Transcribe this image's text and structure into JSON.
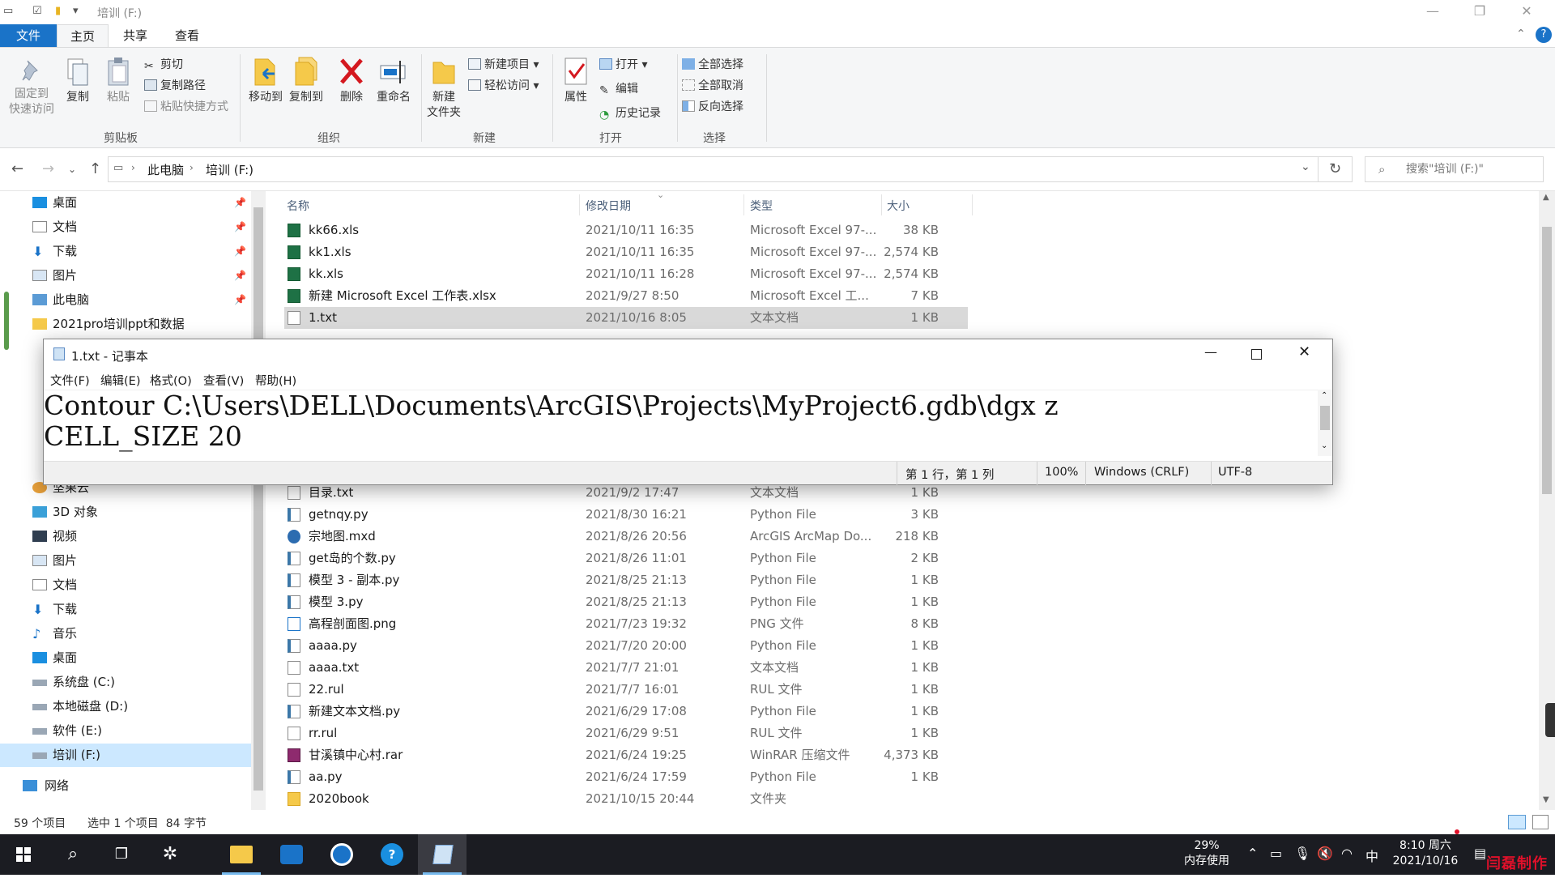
{
  "titlebar": {
    "title": "培训 (F:)",
    "minimize": "—",
    "maximize": "❐",
    "close": "✕"
  },
  "ribbon_tabs": [
    "文件",
    "主页",
    "共享",
    "查看"
  ],
  "ribbon": {
    "clipboard": {
      "pin": "固定到\n快速访问",
      "copy": "复制",
      "paste": "粘贴",
      "cut": "剪切",
      "copy_path": "复制路径",
      "paste_shortcut": "粘贴快捷方式",
      "group": "剪贴板"
    },
    "organize": {
      "move_to": "移动到",
      "copy_to": "复制到",
      "delete": "删除",
      "rename": "重命名",
      "group": "组织"
    },
    "new": {
      "new_folder": "新建\n文件夹",
      "new_item": "新建项目",
      "easy_access": "轻松访问",
      "group": "新建"
    },
    "open": {
      "properties": "属性",
      "open": "打开",
      "edit": "编辑",
      "history": "历史记录",
      "group": "打开"
    },
    "select": {
      "select_all": "全部选择",
      "select_none": "全部取消",
      "invert": "反向选择",
      "group": "选择"
    }
  },
  "address": {
    "crumbs": [
      "此电脑",
      "培训 (F:)"
    ],
    "search_placeholder": "搜索\"培训 (F:)\""
  },
  "nav": {
    "items": [
      {
        "label": "桌面",
        "icon": "desktop-icon",
        "pinned": true
      },
      {
        "label": "文档",
        "icon": "documents-icon",
        "pinned": true
      },
      {
        "label": "下载",
        "icon": "download-icon",
        "pinned": true
      },
      {
        "label": "图片",
        "icon": "pictures-icon",
        "pinned": true
      },
      {
        "label": "此电脑",
        "icon": "pc-icon",
        "pinned": true
      },
      {
        "label": "2021pro培训ppt和数据",
        "icon": "folder-icon",
        "pinned": false
      }
    ],
    "items_lower": [
      {
        "label": "坚果云",
        "icon": "cloud-folder-icon"
      },
      {
        "label": "3D 对象",
        "icon": "3d-objects-icon"
      },
      {
        "label": "视频",
        "icon": "video-icon"
      },
      {
        "label": "图片",
        "icon": "pictures-icon"
      },
      {
        "label": "文档",
        "icon": "documents-icon"
      },
      {
        "label": "下载",
        "icon": "download-icon"
      },
      {
        "label": "音乐",
        "icon": "music-icon"
      },
      {
        "label": "桌面",
        "icon": "desktop-icon"
      },
      {
        "label": "系统盘 (C:)",
        "icon": "drive-icon"
      },
      {
        "label": "本地磁盘 (D:)",
        "icon": "drive-icon"
      },
      {
        "label": "软件 (E:)",
        "icon": "drive-icon"
      },
      {
        "label": "培训 (F:)",
        "icon": "drive-icon",
        "selected": true
      },
      {
        "label": "网络",
        "icon": "network-icon"
      }
    ]
  },
  "columns": {
    "name": "名称",
    "date": "修改日期",
    "type": "类型",
    "size": "大小"
  },
  "files_top": [
    {
      "name": "kk66.xls",
      "date": "2021/10/11 16:35",
      "type": "Microsoft Excel 97-...",
      "size": "38 KB",
      "icon": "excel-icon"
    },
    {
      "name": "kk1.xls",
      "date": "2021/10/11 16:35",
      "type": "Microsoft Excel 97-...",
      "size": "2,574 KB",
      "icon": "excel-icon"
    },
    {
      "name": "kk.xls",
      "date": "2021/10/11 16:28",
      "type": "Microsoft Excel 97-...",
      "size": "2,574 KB",
      "icon": "excel-icon"
    },
    {
      "name": "新建 Microsoft Excel 工作表.xlsx",
      "date": "2021/9/27 8:50",
      "type": "Microsoft Excel 工...",
      "size": "7 KB",
      "icon": "excel-icon"
    },
    {
      "name": "1.txt",
      "date": "2021/10/16 8:05",
      "type": "文本文档",
      "size": "1 KB",
      "icon": "text-file-icon",
      "selected": true
    }
  ],
  "files_bottom": [
    {
      "name": "目录.txt",
      "date": "2021/9/2 17:47",
      "type": "文本文档",
      "size": "1 KB",
      "icon": "text-file-icon"
    },
    {
      "name": "getnqy.py",
      "date": "2021/8/30 16:21",
      "type": "Python File",
      "size": "3 KB",
      "icon": "python-file-icon"
    },
    {
      "name": "宗地图.mxd",
      "date": "2021/8/26 20:56",
      "type": "ArcGIS ArcMap Do...",
      "size": "218 KB",
      "icon": "arcmap-icon"
    },
    {
      "name": "get岛的个数.py",
      "date": "2021/8/26 11:01",
      "type": "Python File",
      "size": "2 KB",
      "icon": "python-file-icon"
    },
    {
      "name": "模型 3 - 副本.py",
      "date": "2021/8/25 21:13",
      "type": "Python File",
      "size": "1 KB",
      "icon": "python-file-icon"
    },
    {
      "name": "模型 3.py",
      "date": "2021/8/25 21:13",
      "type": "Python File",
      "size": "1 KB",
      "icon": "python-file-icon"
    },
    {
      "name": "高程剖面图.png",
      "date": "2021/7/23 19:32",
      "type": "PNG 文件",
      "size": "8 KB",
      "icon": "image-file-icon"
    },
    {
      "name": "aaaa.py",
      "date": "2021/7/20 20:00",
      "type": "Python File",
      "size": "1 KB",
      "icon": "python-file-icon"
    },
    {
      "name": "aaaa.txt",
      "date": "2021/7/7 21:01",
      "type": "文本文档",
      "size": "1 KB",
      "icon": "text-file-icon"
    },
    {
      "name": "22.rul",
      "date": "2021/7/7 16:01",
      "type": "RUL 文件",
      "size": "1 KB",
      "icon": "blank-file-icon"
    },
    {
      "name": "新建文本文档.py",
      "date": "2021/6/29 17:08",
      "type": "Python File",
      "size": "1 KB",
      "icon": "python-file-icon"
    },
    {
      "name": "rr.rul",
      "date": "2021/6/29 9:51",
      "type": "RUL 文件",
      "size": "1 KB",
      "icon": "blank-file-icon"
    },
    {
      "name": "甘溪镇中心村.rar",
      "date": "2021/6/24 19:25",
      "type": "WinRAR 压缩文件",
      "size": "4,373 KB",
      "icon": "rar-icon"
    },
    {
      "name": "aa.py",
      "date": "2021/6/24 17:59",
      "type": "Python File",
      "size": "1 KB",
      "icon": "python-file-icon"
    },
    {
      "name": "2020book",
      "date": "2021/10/15 20:44",
      "type": "文件夹",
      "size": "",
      "icon": "folder-icon"
    }
  ],
  "status": {
    "count": "59 个项目",
    "selected": "选中 1 个项目  84 字节"
  },
  "notepad": {
    "title": "1.txt - 记事本",
    "menu": [
      "文件(F)",
      "编辑(E)",
      "格式(O)",
      "查看(V)",
      "帮助(H)"
    ],
    "line1": "Contour C:\\Users\\DELL\\Documents\\ArcGIS\\Projects\\MyProject6.gdb\\dgx z",
    "line2": "CELL_SIZE 20",
    "status": {
      "position": "第 1 行，第 1 列",
      "zoom": "100%",
      "eol": "Windows (CRLF)",
      "encoding": "UTF-8"
    }
  },
  "taskbar": {
    "memory_pct": "29%",
    "memory_label": "内存使用",
    "ime": "中",
    "time": "8:10 周六",
    "date": "2021/10/16",
    "watermark": "闫磊制作"
  },
  "colors": {
    "accent": "#1a73c8",
    "selection": "#cce8ff",
    "taskbar": "#1b1c22"
  }
}
